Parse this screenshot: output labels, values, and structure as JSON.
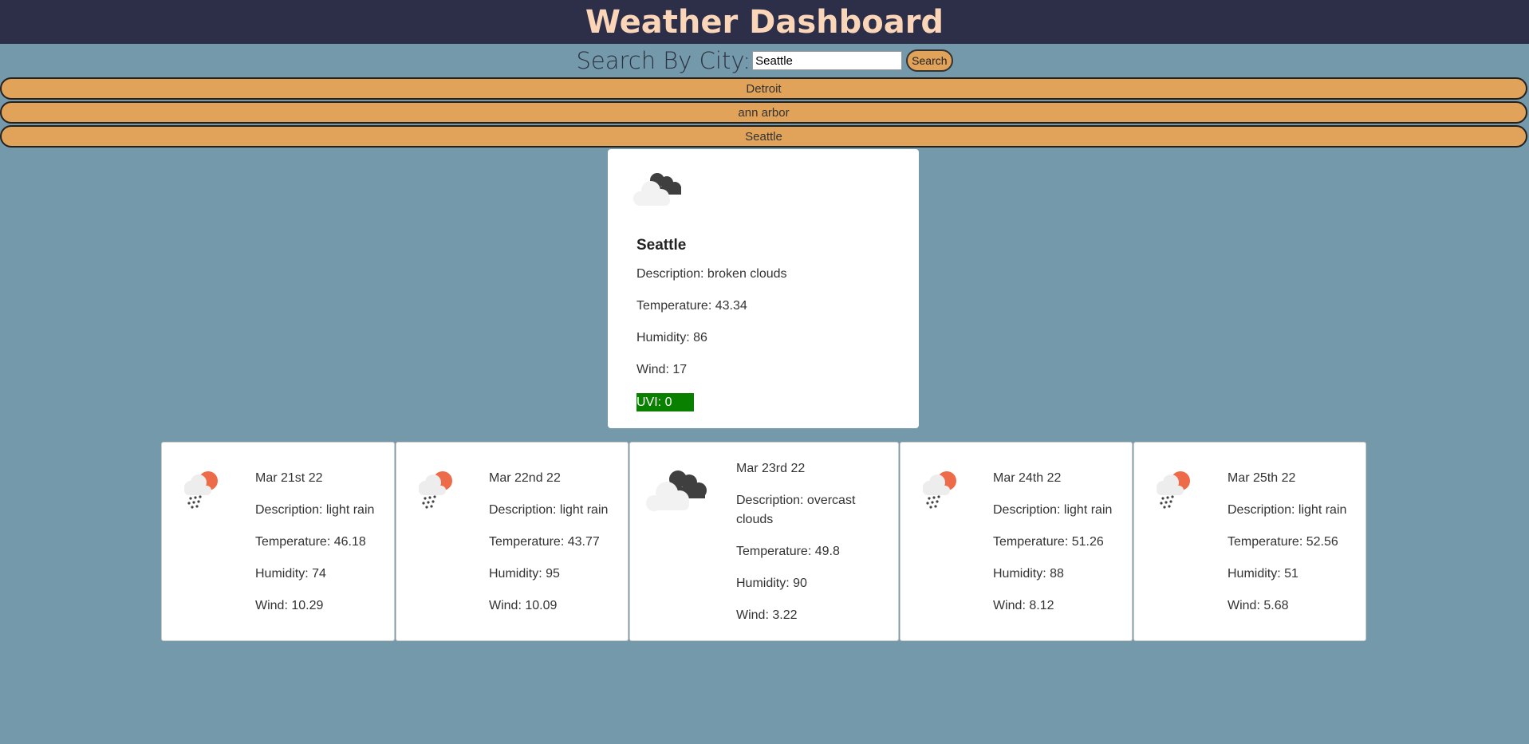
{
  "header": {
    "title": "Weather Dashboard"
  },
  "search": {
    "label": "Search By City:",
    "value": "Seattle",
    "button_label": "Search"
  },
  "history": [
    "Detroit",
    "ann arbor",
    "Seattle"
  ],
  "current": {
    "icon": "broken-clouds-icon",
    "city": "Seattle",
    "description": "Description: broken clouds",
    "temperature": "Temperature: 43.34",
    "humidity": "Humidity: 86",
    "wind": "Wind: 17",
    "uvi": "UVI: 0",
    "uvi_color": "#0a8000"
  },
  "forecast": [
    {
      "icon": "light-rain-icon",
      "date": "Mar 21st 22",
      "description": "Description: light rain",
      "temperature": "Temperature: 46.18",
      "humidity": "Humidity: 74",
      "wind": "Wind: 10.29"
    },
    {
      "icon": "light-rain-icon",
      "date": "Mar 22nd 22",
      "description": "Description: light rain",
      "temperature": "Temperature: 43.77",
      "humidity": "Humidity: 95",
      "wind": "Wind: 10.09"
    },
    {
      "icon": "overcast-clouds-icon",
      "date": "Mar 23rd 22",
      "description": "Description: overcast clouds",
      "temperature": "Temperature: 49.8",
      "humidity": "Humidity: 90",
      "wind": "Wind: 3.22"
    },
    {
      "icon": "light-rain-icon",
      "date": "Mar 24th 22",
      "description": "Description: light rain",
      "temperature": "Temperature: 51.26",
      "humidity": "Humidity: 88",
      "wind": "Wind: 8.12"
    },
    {
      "icon": "light-rain-icon",
      "date": "Mar 25th 22",
      "description": "Description: light rain",
      "temperature": "Temperature: 52.56",
      "humidity": "Humidity: 51",
      "wind": "Wind: 5.68"
    }
  ]
}
